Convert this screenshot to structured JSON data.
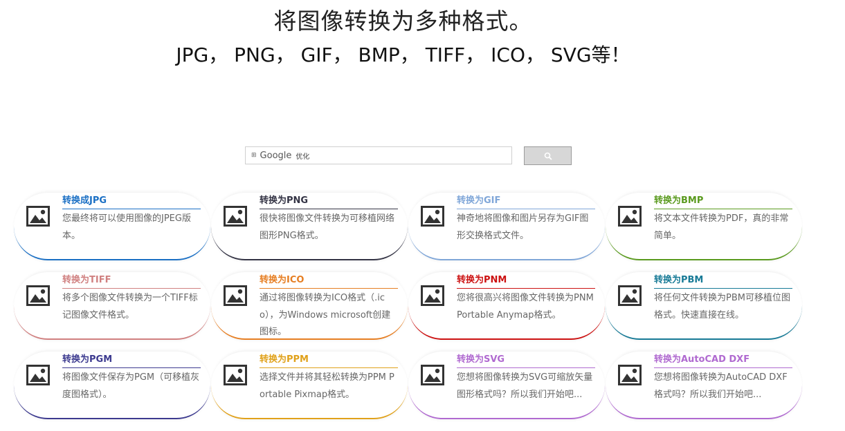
{
  "hero": {
    "title": "将图像转换为多种格式。",
    "subtitle": "JPG， PNG， GIF， BMP， TIFF， ICO， SVG等！"
  },
  "search": {
    "brand": "Google",
    "tag": "优化",
    "value": "",
    "placeholder": ""
  },
  "cards": [
    {
      "title": "转换成JPG",
      "desc": "您最终将可以使用图像的JPEG版本。",
      "color": "#1a6fc4"
    },
    {
      "title": "转换为PNG",
      "desc": "很快将图像文件转换为可移植网络图形PNG格式。",
      "color": "#333344"
    },
    {
      "title": "转换为GIF",
      "desc": "神奇地将图像和图片另存为GIF图形交换格式文件。",
      "color": "#7fa6d8"
    },
    {
      "title": "转换为BMP",
      "desc": "将文本文件转换为PDF，真的非常简单。",
      "color": "#5a9a1e"
    },
    {
      "title": "转换为TIFF",
      "desc": "将多个图像文件转换为一个TIFF标记图像文件格式。",
      "color": "#d08080"
    },
    {
      "title": "转换为ICO",
      "desc": "通过将图像转换为ICO格式（.ico），为Windows microsoft创建图标。",
      "color": "#e67e22"
    },
    {
      "title": "转换为PNM",
      "desc": "您将很高兴将图像文件转换为PNM Portable Anymap格式。",
      "color": "#cc1111"
    },
    {
      "title": "转换为PBM",
      "desc": "将任何文件转换为PBM可移植位图格式。快速直接在线。",
      "color": "#177a96"
    },
    {
      "title": "转换为PGM",
      "desc": "将图像文件保存为PGM（可移植灰度图格式）。",
      "color": "#3c3a8f"
    },
    {
      "title": "转换为PPM",
      "desc": "选择文件并将其轻松转换为PPM Portable Pixmap格式。",
      "color": "#e0a11a"
    },
    {
      "title": "转换为SVG",
      "desc": "您想将图像转换为SVG可缩放矢量图形格式吗？所以我们开始吧...",
      "color": "#b06ad0"
    },
    {
      "title": "转换为AutoCAD DXF",
      "desc": "您想将图像转换为AutoCAD DXF格式吗？所以我们开始吧...",
      "color": "#b06ad0"
    }
  ]
}
